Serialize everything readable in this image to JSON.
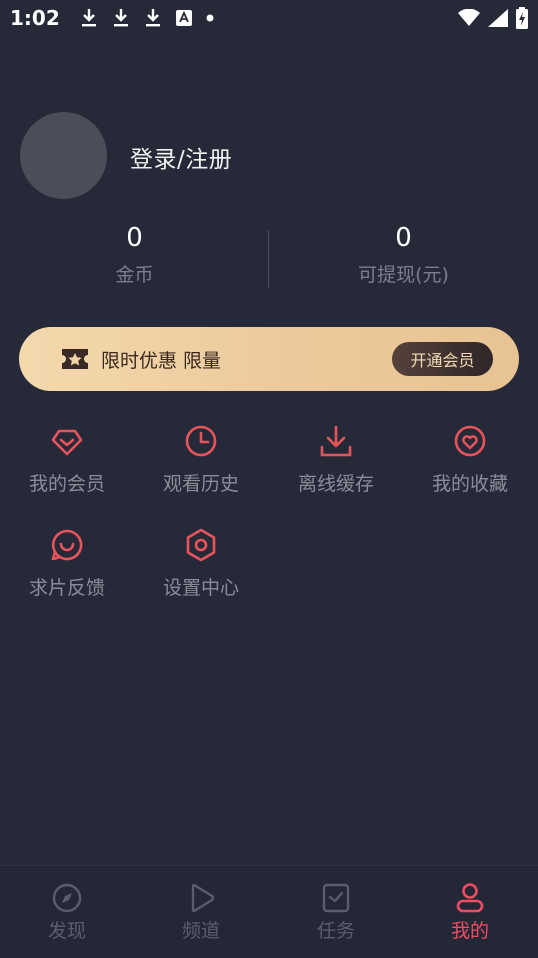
{
  "status_bar": {
    "time": "1:02",
    "icons_left": [
      "download-icon",
      "download-icon",
      "download-icon",
      "translate-icon",
      "dot-icon"
    ],
    "icons_right": [
      "wifi-icon",
      "signal-icon",
      "battery-charging-icon"
    ]
  },
  "profile": {
    "login_label": "登录/注册"
  },
  "stats": {
    "coins_value": "0",
    "coins_label": "金币",
    "withdraw_value": "0",
    "withdraw_label": "可提现(元)"
  },
  "vip_banner": {
    "text": "限时优惠 限量",
    "button_label": "开通会员"
  },
  "menu": {
    "items": [
      {
        "label": "我的会员",
        "icon": "diamond-icon"
      },
      {
        "label": "观看历史",
        "icon": "clock-icon"
      },
      {
        "label": "离线缓存",
        "icon": "download-icon"
      },
      {
        "label": "我的收藏",
        "icon": "heart-icon"
      },
      {
        "label": "求片反馈",
        "icon": "feedback-icon"
      },
      {
        "label": "设置中心",
        "icon": "settings-icon"
      }
    ]
  },
  "bottom_nav": {
    "items": [
      {
        "label": "发现",
        "icon": "compass-icon"
      },
      {
        "label": "频道",
        "icon": "play-icon"
      },
      {
        "label": "任务",
        "icon": "task-icon"
      },
      {
        "label": "我的",
        "icon": "user-icon",
        "active": true
      }
    ]
  },
  "colors": {
    "background": "#262a38",
    "accent": "#f04b63",
    "menu_icon": "#e8545c",
    "vip_gradient_start": "#f3d9ad",
    "vip_gradient_end": "#e8c394"
  }
}
